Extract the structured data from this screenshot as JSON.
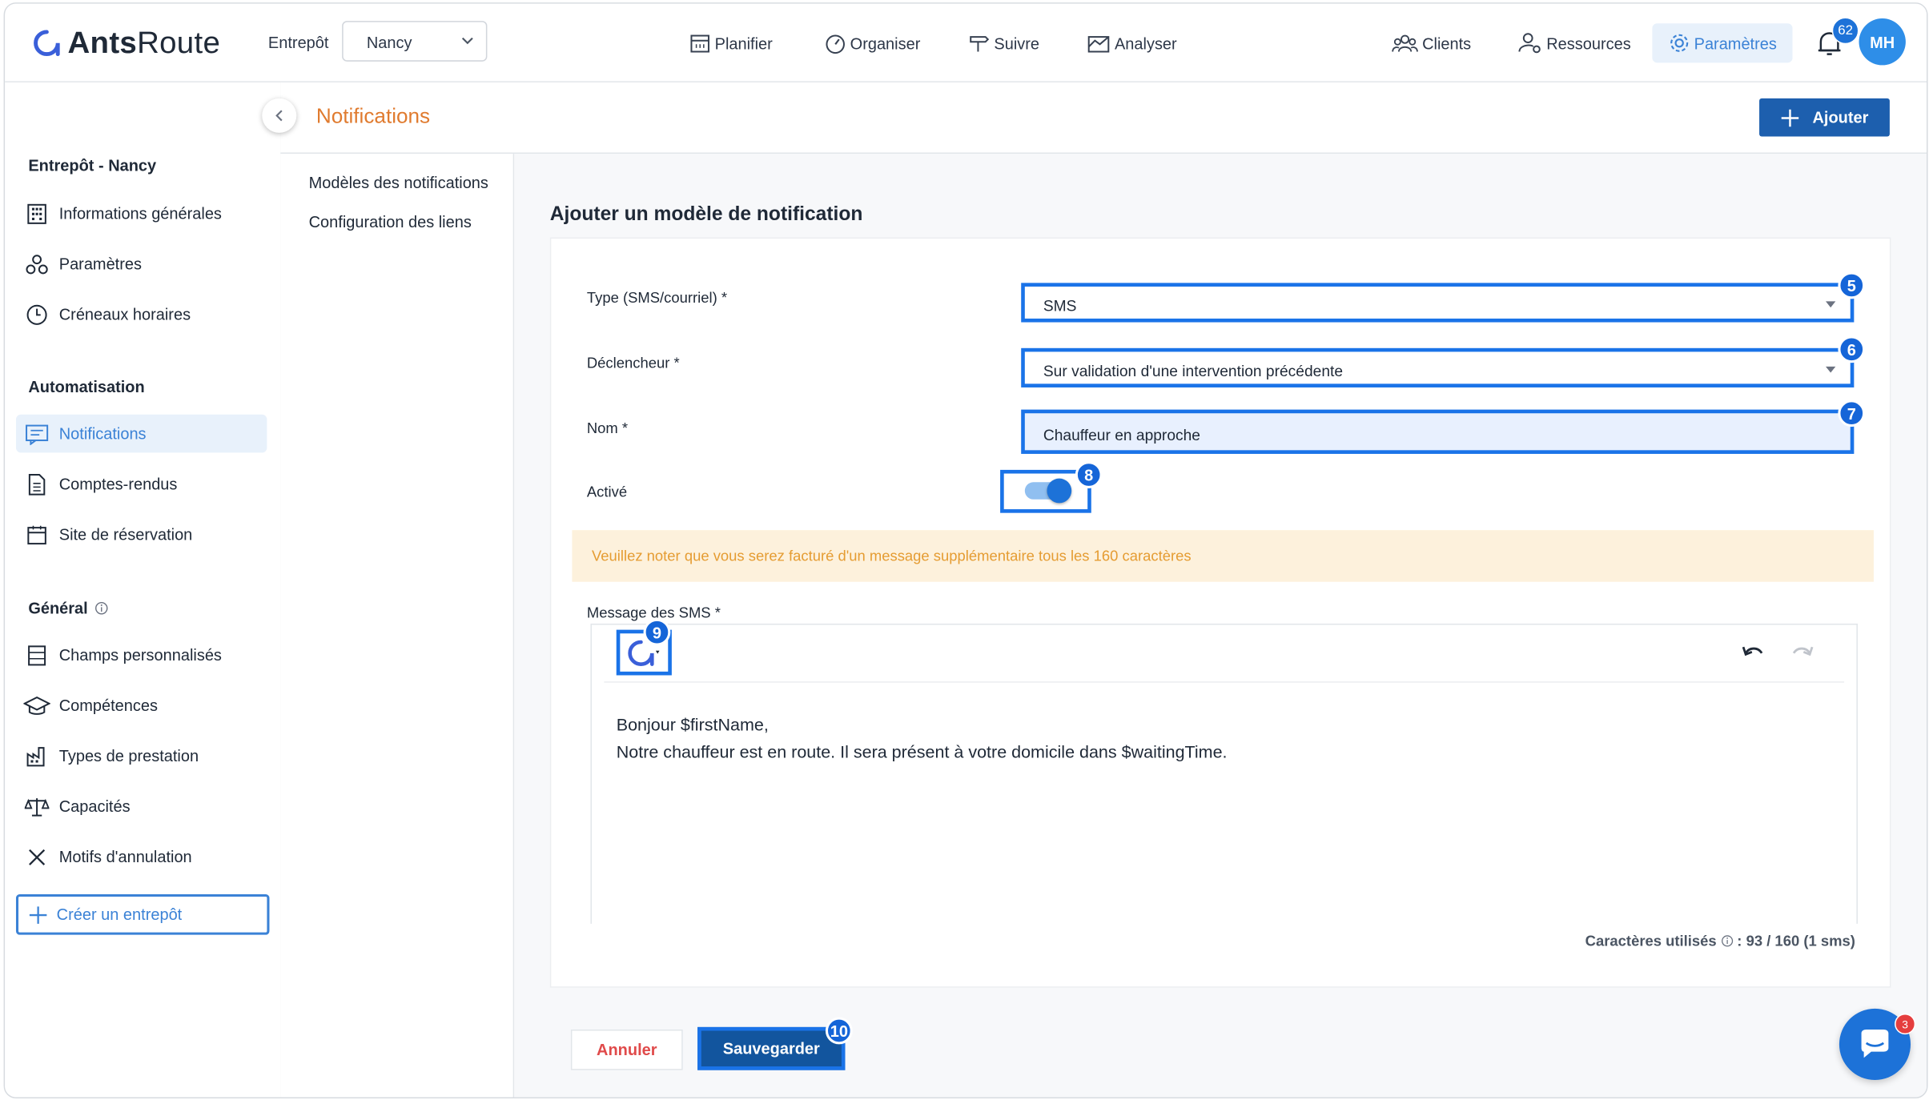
{
  "app": {
    "logo_text_bold": "Ants",
    "logo_text_light": "Route"
  },
  "header": {
    "warehouse_label": "Entrepôt",
    "warehouse_value": "Nancy",
    "nav": [
      {
        "label": "Planifier",
        "icon": "calendar-icon"
      },
      {
        "label": "Organiser",
        "icon": "gauge-icon"
      },
      {
        "label": "Suivre",
        "icon": "signpost-icon"
      },
      {
        "label": "Analyser",
        "icon": "chart-icon"
      },
      {
        "label": "Clients",
        "icon": "users-icon"
      },
      {
        "label": "Ressources",
        "icon": "user-gear-icon"
      },
      {
        "label": "Paramètres",
        "icon": "gear-icon"
      }
    ],
    "notification_count": "62",
    "avatar_initials": "MH"
  },
  "sidebar": {
    "section_warehouse": "Entrepôt - Nancy",
    "warehouse_items": [
      {
        "label": "Informations générales"
      },
      {
        "label": "Paramètres"
      },
      {
        "label": "Créneaux horaires"
      }
    ],
    "section_automation": "Automatisation",
    "automation_items": [
      {
        "label": "Notifications"
      },
      {
        "label": "Comptes-rendus"
      },
      {
        "label": "Site de réservation"
      }
    ],
    "section_general": "Général",
    "general_items": [
      {
        "label": "Champs personnalisés"
      },
      {
        "label": "Compétences"
      },
      {
        "label": "Types de prestation"
      },
      {
        "label": "Capacités"
      },
      {
        "label": "Motifs d'annulation"
      }
    ],
    "create_label": "Créer un entrepôt"
  },
  "page": {
    "title": "Notifications",
    "add_button": "Ajouter",
    "subnav": [
      "Modèles des notifications",
      "Configuration des liens"
    ]
  },
  "form": {
    "title": "Ajouter un modèle de notification",
    "type_label": "Type (SMS/courriel) *",
    "type_value": "SMS",
    "trigger_label": "Déclencheur *",
    "trigger_value": "Sur validation d'une intervention précédente",
    "name_label": "Nom *",
    "name_value": "Chauffeur en approche",
    "active_label": "Activé",
    "active": true,
    "warning": "Veuillez noter que vous serez facturé d'un message supplémentaire tous les 160 caractères",
    "message_label": "Message des SMS *",
    "message_line1": "Bonjour  $firstName,",
    "message_line2": "Notre chauffeur est en route. Il sera présent à votre domicile dans  $waitingTime.",
    "counter_label": "Caractères utilisés",
    "counter_value": ": 93 / 160 (1 sms)",
    "cancel": "Annuler",
    "save": "Sauvegarder"
  },
  "annotations": {
    "m5": "5",
    "m6": "6",
    "m7": "7",
    "m8": "8",
    "m9": "9",
    "m10": "10"
  },
  "chat": {
    "badge": "3"
  },
  "colors": {
    "accent": "#3b82d6",
    "highlight": "#1a73e8",
    "title_orange": "#e07b2f",
    "primary_button": "#1d5fae"
  }
}
